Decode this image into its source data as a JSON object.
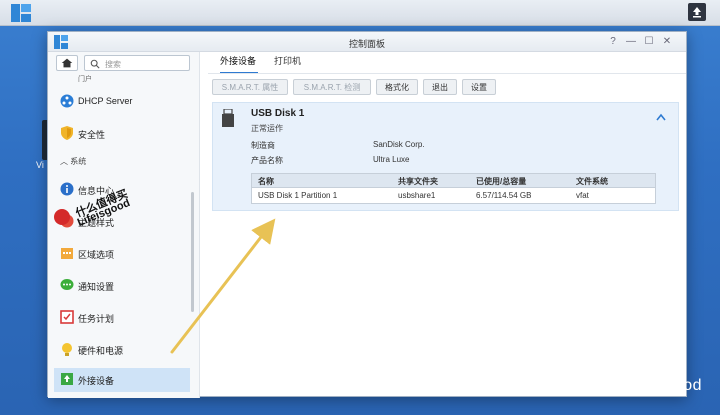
{
  "desktop": {
    "label": "Vi"
  },
  "window": {
    "title": "控制面板",
    "controls": {
      "help": "?",
      "minimize": "—",
      "maximize": "☐",
      "close": "✕"
    }
  },
  "sidebar": {
    "search_placeholder": "搜索",
    "cut_item": "门户",
    "items": [
      {
        "label": "DHCP Server",
        "icon": "dhcp-icon"
      },
      {
        "label": "安全性",
        "icon": "shield-icon"
      },
      {
        "label": "信息中心",
        "icon": "info-icon"
      },
      {
        "label": "主题样式",
        "icon": "theme-icon"
      },
      {
        "label": "区域选项",
        "icon": "calendar-icon"
      },
      {
        "label": "通知设置",
        "icon": "notification-icon"
      },
      {
        "label": "任务计划",
        "icon": "task-icon"
      },
      {
        "label": "硬件和电源",
        "icon": "bulb-icon"
      },
      {
        "label": "外接设备",
        "icon": "external-device-icon"
      }
    ],
    "section": "系统",
    "active_item": "外接设备"
  },
  "tabs": [
    {
      "label": "外接设备",
      "active": true
    },
    {
      "label": "打印机",
      "active": false
    }
  ],
  "toolbar": [
    {
      "label": "S.M.A.R.T. 属性",
      "disabled": true
    },
    {
      "label": "S.M.A.R.T. 检测",
      "disabled": true
    },
    {
      "label": "格式化",
      "disabled": false
    },
    {
      "label": "退出",
      "disabled": false
    },
    {
      "label": "设置",
      "disabled": false
    }
  ],
  "device": {
    "name": "USB Disk 1",
    "status": "正常运作",
    "manufacturer_key": "制造商",
    "manufacturer": "SanDisk Corp.",
    "product_key": "产品名称",
    "product": "Ultra Luxe",
    "partitions": {
      "headers": [
        "名称",
        "共享文件夹",
        "已使用/总容量",
        "文件系统"
      ],
      "rows": [
        [
          "USB Disk 1 Partition 1",
          "usbshare1",
          "6.57/114.54 GB",
          "vfat"
        ]
      ]
    }
  },
  "overlay": {
    "stamp_line1": "什么值得买",
    "stamp_line2": "Lifeisgood",
    "watermark": "知乎 @Lifeisgood",
    "arrow_color": "#e8c255"
  }
}
